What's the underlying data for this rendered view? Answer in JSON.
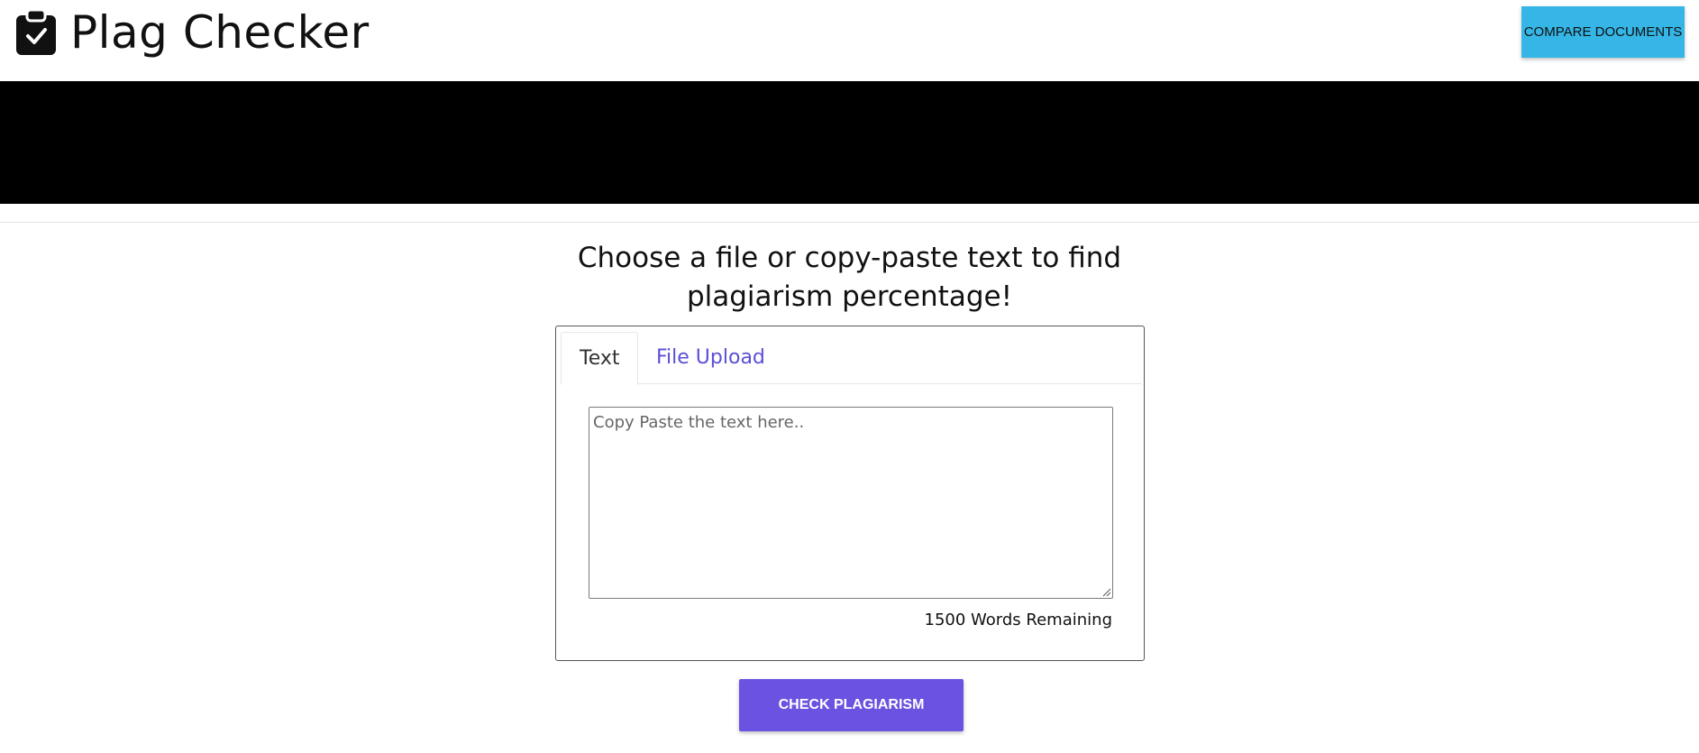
{
  "header": {
    "title": "Plag Checker",
    "logo_icon": "clipboard-check-icon",
    "compare_button_label": "COMPARE DOCUMENTS"
  },
  "main": {
    "heading_line1": "Choose a file or copy-paste text to find",
    "heading_line2": "plagiarism percentage!",
    "tabs": [
      {
        "label": "Text",
        "active": true
      },
      {
        "label": "File Upload",
        "active": false
      }
    ],
    "textarea": {
      "value": "",
      "placeholder": "Copy Paste the text here.."
    },
    "words_remaining": "1500 Words Remaining",
    "check_button_label": "CHECK PLAGIARISM"
  },
  "colors": {
    "compare_button_bg": "#35b6e6",
    "check_button_bg": "#6b52e0",
    "inactive_tab_text": "#5b4fd6",
    "banner_bg": "#000000"
  }
}
